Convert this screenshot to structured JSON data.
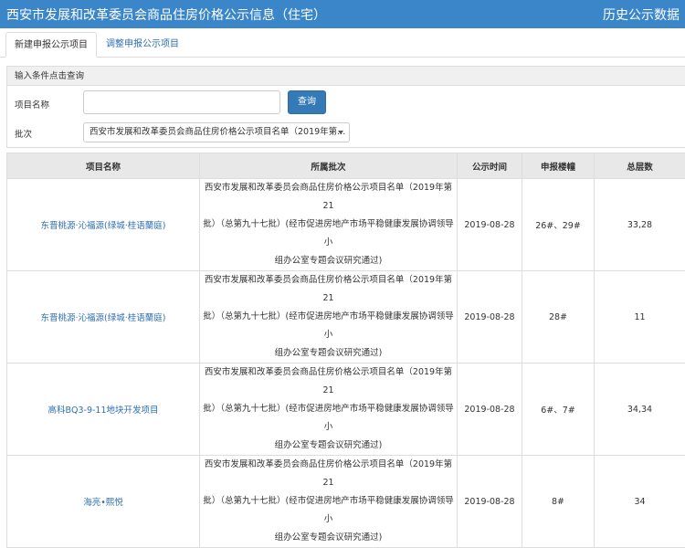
{
  "header": {
    "title": "西安市发展和改革委员会商品住房价格公示信息（住宅）",
    "history_link": "历史公示数据"
  },
  "tabs": [
    {
      "label": "新建申报公示项目",
      "active": true
    },
    {
      "label": "调整申报公示项目",
      "active": false
    }
  ],
  "query": {
    "heading": "输入条件点击查询",
    "name_label": "项目名称",
    "name_value": "",
    "name_placeholder": "",
    "search_button": "查询",
    "batch_label": "批次",
    "batch_selected": "西安市发展和改革委员会商品住房价格公示项目名单（2019年第..."
  },
  "table": {
    "columns": [
      "项目名称",
      "所属批次",
      "公示时间",
      "申报楼幢",
      "总层数"
    ],
    "rows": [
      {
        "project": "东晋桃源·沁福源(绿城·桂语蘭庭)",
        "batch_lines": [
          "西安市发展和改革委员会商品住房价格公示项目名单（2019年第21",
          "批）（总第九十七批）(经市促进房地产市场平稳健康发展协调领导小",
          "组办公室专题会议研究通过)"
        ],
        "date": "2019-08-28",
        "buildings": "26#、29#",
        "floors": "33,28"
      },
      {
        "project": "东晋桃源·沁福源(绿城·桂语蘭庭)",
        "batch_lines": [
          "西安市发展和改革委员会商品住房价格公示项目名单（2019年第21",
          "批）（总第九十七批）(经市促进房地产市场平稳健康发展协调领导小",
          "组办公室专题会议研究通过)"
        ],
        "date": "2019-08-28",
        "buildings": "28#",
        "floors": "11"
      },
      {
        "project": "高科BQ3-9-11地块开发项目",
        "batch_lines": [
          "西安市发展和改革委员会商品住房价格公示项目名单（2019年第21",
          "批）（总第九十七批）(经市促进房地产市场平稳健康发展协调领导小",
          "组办公室专题会议研究通过)"
        ],
        "date": "2019-08-28",
        "buildings": "6#、7#",
        "floors": "34,34"
      },
      {
        "project": "海亮•熙悦",
        "batch_lines": [
          "西安市发展和改革委员会商品住房价格公示项目名单（2019年第21",
          "批）（总第九十七批）(经市促进房地产市场平稳健康发展协调领导小",
          "组办公室专题会议研究通过)"
        ],
        "date": "2019-08-28",
        "buildings": "8#",
        "floors": "34"
      }
    ]
  }
}
